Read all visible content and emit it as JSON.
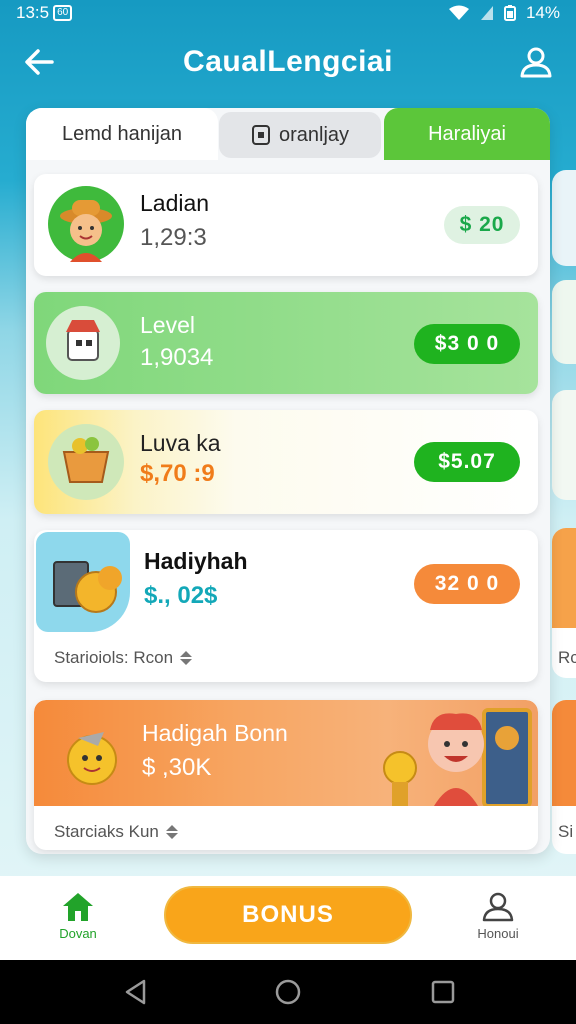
{
  "status_bar": {
    "time": "13:5",
    "badge": "60",
    "battery": "14%"
  },
  "header": {
    "title": "CaualLengciai"
  },
  "tabs": [
    {
      "label": "Lemd hanijan"
    },
    {
      "label": "oranljay"
    },
    {
      "label": "Haraliyai"
    }
  ],
  "cards": [
    {
      "name": "Ladian",
      "value": "1,29:3",
      "reward": "$ 20"
    },
    {
      "name": "Level",
      "value": "1,9034",
      "reward": "$3 0 0"
    },
    {
      "name": "Luva ka",
      "value": "$,70 :9",
      "reward": "$5.07"
    },
    {
      "name": "Hadiyhah",
      "value": "$., 02$",
      "reward": "32 0 0",
      "footer": "Starioiols: Rcon"
    },
    {
      "name": "Hadigah Bonn",
      "value": "$ ,30K",
      "footer": "Starciaks Kun"
    }
  ],
  "bottom_nav": {
    "left_label": "Dovan",
    "bonus_label": "BONUS",
    "right_label": "Honoui"
  },
  "side_peek": {
    "label_1": "Rc",
    "label_2": "Si"
  },
  "colors": {
    "accent_green": "#5cc63a",
    "pill_green": "#1fb31f",
    "accent_orange": "#f58a3a",
    "bonus_yellow": "#f9a51a",
    "header_blue": "#169ac2"
  }
}
